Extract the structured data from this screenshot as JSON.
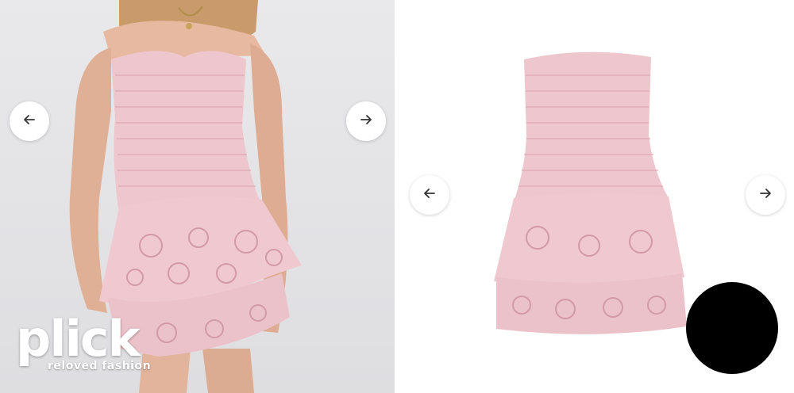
{
  "gallery_left": {
    "prev_icon": "arrow-left-icon",
    "next_icon": "arrow-right-icon",
    "brand": {
      "name": "plick",
      "tagline": "reloved fashion"
    }
  },
  "gallery_right": {
    "prev_icon": "arrow-left-icon",
    "next_icon": "arrow-right-icon"
  },
  "colors": {
    "dress_pink": "#eec6cd",
    "dress_shadow": "#d9a8b1",
    "skin": "#e2b49c",
    "overlay_dot": "#000000"
  }
}
